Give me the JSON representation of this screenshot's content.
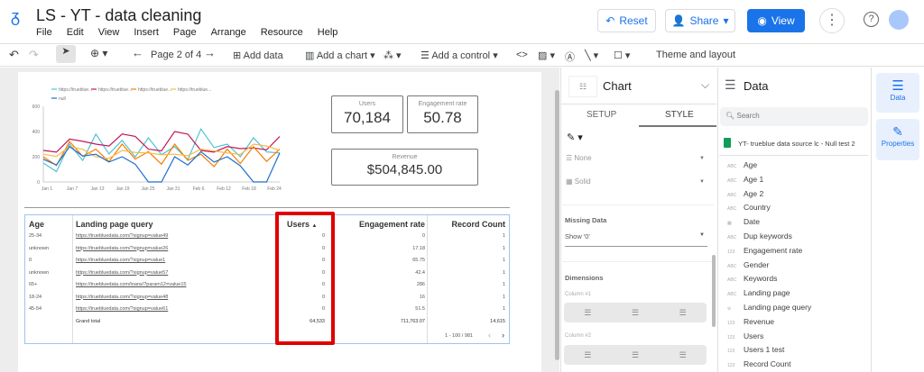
{
  "header": {
    "title": "LS - YT - data cleaning",
    "menu": [
      "File",
      "Edit",
      "View",
      "Insert",
      "Page",
      "Arrange",
      "Resource",
      "Help"
    ],
    "reset": "Reset",
    "share": "Share",
    "view": "View"
  },
  "toolbar": {
    "page": "Page 2 of 4",
    "add_data": "Add data",
    "add_chart": "Add a chart",
    "add_control": "Add a control",
    "theme": "Theme and layout"
  },
  "scorecards": {
    "users": {
      "label": "Users",
      "value": "70,184"
    },
    "engagement": {
      "label": "Engagement rate",
      "value": "50.78"
    },
    "revenue": {
      "label": "Revenue",
      "value": "$504,845.00"
    }
  },
  "chart_data": {
    "type": "line",
    "x": [
      "Jan 1",
      "Jan 7",
      "Jan 13",
      "Jan 19",
      "Jan 25",
      "Jan 31",
      "Feb 6",
      "Feb 12",
      "Feb 18",
      "Feb 24"
    ],
    "ylim": [
      0,
      600
    ],
    "yticks": [
      "0",
      "200",
      "400",
      "600"
    ],
    "series": [
      {
        "name": "https://trueblue...",
        "color": "#4ec3d4",
        "values": [
          150,
          300,
          380,
          330,
          350,
          280,
          420,
          300,
          350,
          230
        ]
      },
      {
        "name": "https://trueblue...",
        "color": "#c2185b",
        "values": [
          250,
          340,
          300,
          380,
          260,
          400,
          250,
          280,
          270,
          360
        ]
      },
      {
        "name": "https://trueblue...",
        "color": "#f57c00",
        "values": [
          200,
          320,
          260,
          300,
          240,
          300,
          220,
          260,
          280,
          260
        ]
      },
      {
        "name": "https://trueblue...",
        "color": "#f9b94a",
        "values": [
          220,
          280,
          200,
          250,
          230,
          220,
          260,
          230,
          300,
          250
        ]
      },
      {
        "name": "null",
        "color": "#1e6fd0",
        "values": [
          180,
          280,
          220,
          200,
          0,
          200,
          240,
          200,
          0,
          230
        ]
      }
    ]
  },
  "table": {
    "headers": [
      "Age",
      "Landing page query",
      "Users",
      "Engagement rate",
      "Record Count"
    ],
    "rows": [
      [
        "25-34",
        "https://truebluedata.com/?signup=value49",
        "0",
        "0",
        "1"
      ],
      [
        "unknown",
        "https://truebluedata.com/?signup=value26",
        "0",
        "17.18",
        "1"
      ],
      [
        "0",
        "https://truebluedata.com/?signup=value1",
        "0",
        "65.75",
        "1"
      ],
      [
        "unknown",
        "https://truebluedata.com/?signup=value57",
        "0",
        "42.4",
        "1"
      ],
      [
        "65+",
        "https://truebluedata.com/loans/?param12=value15",
        "0",
        "286",
        "1"
      ],
      [
        "18-24",
        "https://truebluedata.com/?signup=value48",
        "0",
        "16",
        "1"
      ],
      [
        "45-54",
        "https://truebluedata.com/?signup=value61",
        "0",
        "51.5",
        "1"
      ]
    ],
    "total": {
      "label": "Grand total",
      "users": "64,533",
      "engagement": "711,763.07",
      "records": "14,615"
    },
    "pagination": "1 - 100 / 981"
  },
  "chart_panel": {
    "title": "Chart",
    "tabs": [
      "SETUP",
      "STYLE"
    ],
    "border_style": "None",
    "line_style": "Solid",
    "missing_label": "Missing Data",
    "missing_value": "Show '0'",
    "dimensions": "Dimensions",
    "col1": "Column #1",
    "col2": "Column #2"
  },
  "data_panel": {
    "title": "Data",
    "search": "Search",
    "source": "YT- trueblue data source lc - Null test 2",
    "fields": [
      {
        "t": "ABC",
        "n": "Age"
      },
      {
        "t": "ABC",
        "n": "Age 1"
      },
      {
        "t": "ABC",
        "n": "Age 2"
      },
      {
        "t": "ABC",
        "n": "Country"
      },
      {
        "t": "▦",
        "n": "Date"
      },
      {
        "t": "ABC",
        "n": "Dup keywords"
      },
      {
        "t": "123",
        "n": "Engagement rate"
      },
      {
        "t": "ABC",
        "n": "Gender"
      },
      {
        "t": "ABC",
        "n": "Keywords"
      },
      {
        "t": "ABC",
        "n": "Landing page"
      },
      {
        "t": "⊖",
        "n": "Landing page query"
      },
      {
        "t": "123",
        "n": "Revenue"
      },
      {
        "t": "123",
        "n": "Users"
      },
      {
        "t": "123",
        "n": "Users 1 test"
      },
      {
        "t": "123",
        "n": "Record Count"
      }
    ]
  },
  "rail": {
    "data": "Data",
    "properties": "Properties"
  }
}
